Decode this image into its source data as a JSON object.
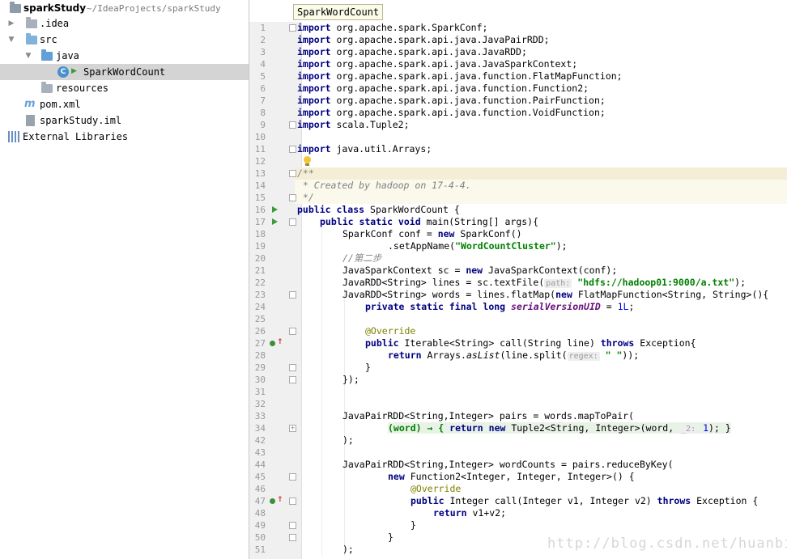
{
  "project": {
    "root_name": "sparkStudy",
    "root_path": "~/IdeaProjects/sparkStudy",
    "items": [
      {
        "label": ".idea"
      },
      {
        "label": "src"
      },
      {
        "label": "java"
      },
      {
        "label": "SparkWordCount"
      },
      {
        "label": "resources"
      },
      {
        "label": "pom.xml"
      },
      {
        "label": "sparkStudy.iml"
      },
      {
        "label": "External Libraries"
      }
    ]
  },
  "editor": {
    "breadcrumb": "SparkWordCount",
    "line_numbers": [
      "1",
      "2",
      "3",
      "4",
      "5",
      "6",
      "7",
      "8",
      "9",
      "10",
      "11",
      "12",
      "13",
      "14",
      "15",
      "16",
      "17",
      "18",
      "19",
      "20",
      "21",
      "22",
      "23",
      "24",
      "25",
      "26",
      "27",
      "28",
      "29",
      "30",
      "31",
      "32",
      "33",
      "34",
      "42",
      "43",
      "44",
      "45",
      "46",
      "47",
      "48",
      "49",
      "50",
      "51"
    ],
    "code": {
      "l1": "org.apache.spark.SparkConf;",
      "l2": "org.apache.spark.api.java.JavaPairRDD;",
      "l3": "org.apache.spark.api.java.JavaRDD;",
      "l4": "org.apache.spark.api.java.JavaSparkContext;",
      "l5": "org.apache.spark.api.java.function.FlatMapFunction;",
      "l6": "org.apache.spark.api.java.function.Function2;",
      "l7": "org.apache.spark.api.java.function.PairFunction;",
      "l8": "org.apache.spark.api.java.function.VoidFunction;",
      "l9": "scala.Tuple2;",
      "l11": "java.util.Arrays;",
      "kw_import": "import",
      "l13": "/**",
      "l14": " * Created by hadoop on 17-4-4.",
      "l15": " */",
      "l16_kw": "public class",
      "l16_rest": " SparkWordCount {",
      "l17_kw": "public static void",
      "l17_rest": " main(String[] args){",
      "l18_a": "SparkConf conf = ",
      "kw_new": "new",
      "l18_b": " SparkConf()",
      "l19_a": ".setAppName(",
      "l19_str": "\"WordCountCluster\"",
      "l19_b": ");",
      "l20": "//第二步",
      "l21_a": "JavaSparkContext sc = ",
      "l21_b": " JavaSparkContext(conf);",
      "l22_a": "JavaRDD<String> lines = sc.textFile(",
      "l22_hint": "path:",
      "l22_str": "\"hdfs://hadoop01:9000/a.txt\"",
      "l22_b": ");",
      "l23_a": "JavaRDD<String> words = lines.flatMap(",
      "l23_b": " FlatMapFunction<String, String>(){",
      "l24_kw": "private static final long",
      "l24_fld": "serialVersionUID",
      "l24_eq": " = ",
      "l24_num": "1L",
      "l24_end": ";",
      "l26": "@Override",
      "kw_public": "public",
      "l27_a": " Iterable<String> call(String line) ",
      "kw_throws": "throws",
      "l27_b": " Exception{",
      "kw_return": "return",
      "l28_a": " Arrays.",
      "l28_it": "asList",
      "l28_b": "(line.split(",
      "l28_hint": "regex:",
      "l28_str": "\" \"",
      "l28_c": "));",
      "brace": "}",
      "l30": "});",
      "l33": "JavaPairRDD<String,Integer> pairs = words.mapToPair(",
      "l34_a": "(word) → { ",
      "l34_b": " Tuple2<String, Integer>(word,",
      "l34_hint": "_2:",
      "l34_num": "1",
      "l34_c": "); }",
      "l42": ");",
      "l44": "JavaPairRDD<String,Integer> wordCounts = pairs.reduceByKey(",
      "l45_b": " Function2<Integer, Integer, Integer>() {",
      "l47_a": " Integer call(Integer v1, Integer v2) ",
      "l47_b": " Exception {",
      "l48_b": " v1+v2;",
      "l51": ");"
    }
  },
  "watermark": "http://blog.csdn.net/huanbia",
  "colors": {
    "keyword": "#000080",
    "string": "#008000",
    "comment": "#808080",
    "annotation": "#808000",
    "selection": "#d4d4d4",
    "highlight_line": "#f5eed6"
  }
}
